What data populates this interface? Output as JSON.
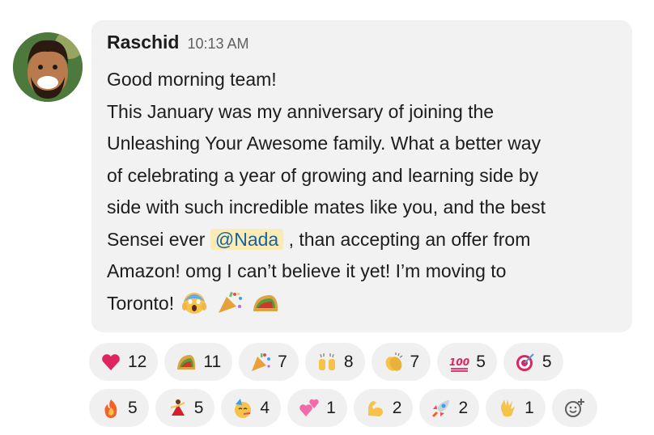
{
  "message": {
    "author": "Raschid",
    "time": "10:13 AM",
    "lines": {
      "l1": "Good morning team!",
      "l2": "This January was my anniversary of joining the",
      "l3": "Unleashing Your Awesome family. What a better way",
      "l4": "of celebrating a year of growing and learning side by",
      "l5": "side with such incredible mates like you, and the best",
      "l6a": "Sensei ever",
      "mention": "@Nada",
      "l6b": ", than accepting an offer from",
      "l7": "Amazon! omg I can’t believe it yet! I’m moving to",
      "l8": "Toronto!"
    },
    "inline_emojis": [
      "scream-icon",
      "party-popper-icon",
      "taco-icon"
    ]
  },
  "reactions": [
    {
      "icon": "heart-icon",
      "count": "12"
    },
    {
      "icon": "taco-icon",
      "count": "11"
    },
    {
      "icon": "party-popper-icon",
      "count": "7"
    },
    {
      "icon": "raised-hands-icon",
      "count": "8"
    },
    {
      "icon": "clap-icon",
      "count": "7"
    },
    {
      "icon": "hundred-icon",
      "count": "5"
    },
    {
      "icon": "target-icon",
      "count": "5"
    },
    {
      "icon": "fire-icon",
      "count": "5"
    },
    {
      "icon": "dancer-icon",
      "count": "5"
    },
    {
      "icon": "partying-face-icon",
      "count": "4"
    },
    {
      "icon": "two-hearts-icon",
      "count": "1"
    },
    {
      "icon": "flexed-biceps-icon",
      "count": "2"
    },
    {
      "icon": "rocket-icon",
      "count": "2"
    },
    {
      "icon": "vulcan-salute-icon",
      "count": "1"
    }
  ],
  "colors": {
    "bubble": "#f2f2f2",
    "mention_bg": "#fcebb5",
    "mention_text": "#1264a3"
  }
}
